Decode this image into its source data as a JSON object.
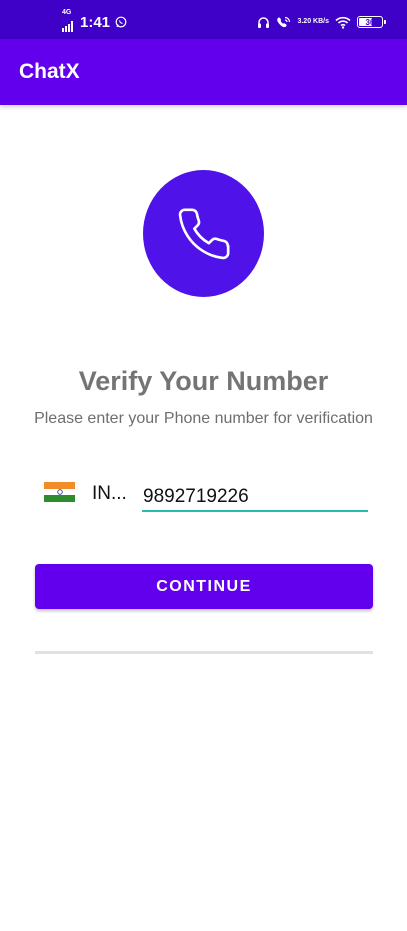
{
  "status_bar": {
    "network": "4G",
    "time": "1:41",
    "speed": "3.20 KB/s",
    "battery": "36"
  },
  "app_bar": {
    "title": "ChatX"
  },
  "main": {
    "title": "Verify Your Number",
    "subtitle": "Please enter your Phone number for verification",
    "country_code": "IN...",
    "phone_number": "9892719226",
    "continue_label": "CONTINUE"
  },
  "icons": {
    "phone": "phone-icon",
    "flag": "india-flag-icon",
    "whatsapp": "whatsapp-icon",
    "headset": "headset-icon",
    "wifi": "wifi-icon",
    "battery": "battery-icon"
  },
  "colors": {
    "primary": "#6200ee",
    "status_bar": "#3f00c8",
    "phone_circle": "#4f12e8",
    "input_underline": "#26bcb4",
    "title_text": "#747474"
  }
}
